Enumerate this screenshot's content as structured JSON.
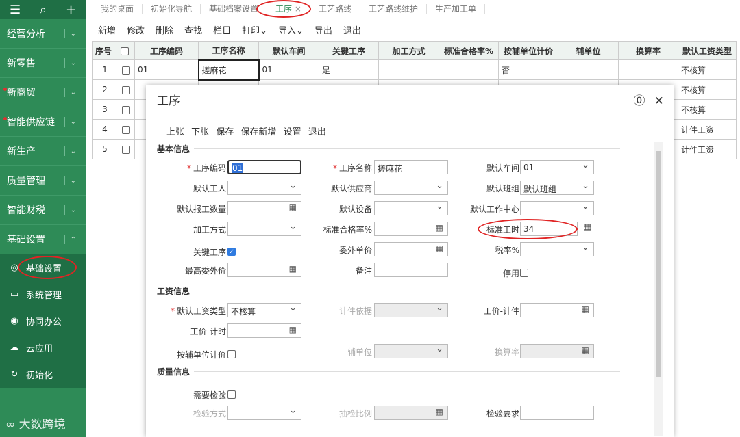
{
  "sidebar": {
    "top_icons": [
      "menu-icon",
      "search-icon",
      "plus-icon"
    ],
    "items": [
      {
        "label": "经营分析",
        "dot": false
      },
      {
        "label": "新零售",
        "dot": false
      },
      {
        "label": "新商贸",
        "dot": true
      },
      {
        "label": "智能供应链",
        "dot": true
      },
      {
        "label": "新生产",
        "dot": false
      },
      {
        "label": "质量管理",
        "dot": false
      },
      {
        "label": "智能财税",
        "dot": false
      },
      {
        "label": "基础设置",
        "dot": false
      }
    ],
    "sub_items": [
      {
        "label": "基础设置",
        "icon": "gear-icon"
      },
      {
        "label": "系统管理",
        "icon": "monitor-icon"
      },
      {
        "label": "协同办公",
        "icon": "share-icon"
      },
      {
        "label": "云应用",
        "icon": "cloud-icon"
      },
      {
        "label": "初始化",
        "icon": "refresh-icon"
      }
    ],
    "brand": "大数跨境"
  },
  "tabs": [
    "我的桌面",
    "初始化导航",
    "基础档案设置",
    "工序",
    "工艺路线",
    "工艺路线维护",
    "生产加工单"
  ],
  "toolbar": [
    "新增",
    "修改",
    "删除",
    "查找",
    "栏目",
    "打印⌄",
    "导入⌄",
    "导出",
    "退出"
  ],
  "grid": {
    "headers": [
      "序号",
      "",
      "工序编码",
      "工序名称",
      "默认车间",
      "关键工序",
      "加工方式",
      "标准合格率%",
      "按辅单位计价",
      "辅单位",
      "换算率",
      "默认工资类型"
    ],
    "rows": [
      {
        "no": "1",
        "code": "01",
        "name": "搓麻花",
        "workshop": "01",
        "key": "是",
        "method": "",
        "rate": "",
        "aux": "否",
        "wage": "不核算"
      },
      {
        "no": "2",
        "code": "",
        "name": "",
        "workshop": "",
        "key": "",
        "method": "",
        "rate": "",
        "aux": "",
        "wage": "不核算"
      },
      {
        "no": "3",
        "code": "",
        "name": "",
        "workshop": "",
        "key": "",
        "method": "",
        "rate": "",
        "aux": "",
        "wage": "不核算"
      },
      {
        "no": "4",
        "code": "",
        "name": "",
        "workshop": "",
        "key": "",
        "method": "",
        "rate": "",
        "aux": "",
        "wage": "计件工资"
      },
      {
        "no": "5",
        "code": "",
        "name": "",
        "workshop": "",
        "key": "",
        "method": "",
        "rate": "",
        "aux": "",
        "wage": "计件工资"
      }
    ]
  },
  "modal": {
    "title": "工序",
    "actions": [
      "上张",
      "下张",
      "保存",
      "保存新增",
      "设置",
      "退出"
    ],
    "sections": {
      "basic": "基本信息",
      "wage": "工资信息",
      "quality": "质量信息"
    },
    "fields": {
      "code_label": "工序编码",
      "code_value": "01",
      "name_label": "工序名称",
      "name_value": "搓麻花",
      "workshop_label": "默认车间",
      "workshop_value": "01",
      "worker_label": "默认工人",
      "supplier_label": "默认供应商",
      "team_label": "默认班组",
      "team_value": "默认班组",
      "report_qty_label": "默认报工数量",
      "device_label": "默认设备",
      "center_label": "默认工作中心",
      "method_label": "加工方式",
      "pass_rate_label": "标准合格率%",
      "std_hours_label": "标准工时",
      "std_hours_value": "34",
      "key_label": "关键工序",
      "outsource_price_label": "委外单价",
      "tax_label": "税率%",
      "max_outsource_label": "最高委外价",
      "remark_label": "备注",
      "disable_label": "停用",
      "wage_type_label": "默认工资类型",
      "wage_type_value": "不核算",
      "piece_basis_label": "计件依据",
      "piece_price_label": "工价-计件",
      "time_price_label": "工价-计时",
      "aux_price_label": "按辅单位计价",
      "aux_unit_label": "辅单位",
      "conv_label": "换算率",
      "need_inspect_label": "需要检验",
      "inspect_method_label": "检验方式",
      "sample_ratio_label": "抽检比例",
      "inspect_req_label": "检验要求"
    }
  }
}
